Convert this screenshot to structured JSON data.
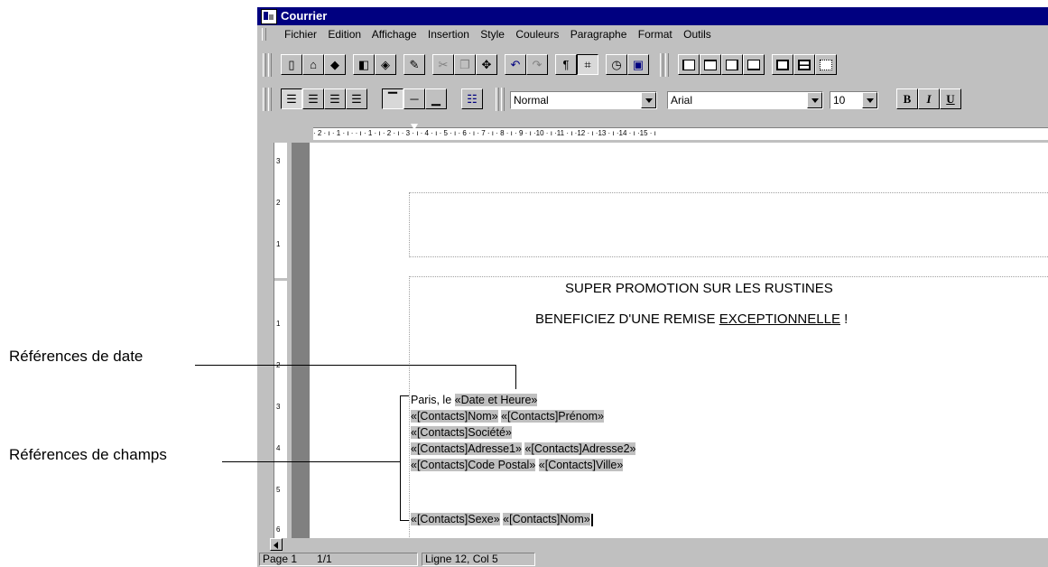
{
  "annotations": {
    "date_ref_label": "Références de date",
    "fields_ref_label": "Références de champs"
  },
  "window": {
    "title": "Courrier",
    "icon": "app-document-icon"
  },
  "menubar": {
    "items": [
      "Fichier",
      "Edition",
      "Affichage",
      "Insertion",
      "Style",
      "Couleurs",
      "Paragraphe",
      "Format",
      "Outils"
    ]
  },
  "toolbar1": {
    "buttons": [
      {
        "icon": "new-document-icon",
        "glyph": "▯"
      },
      {
        "icon": "open-icon",
        "glyph": "⌂"
      },
      {
        "icon": "save-icon",
        "glyph": "◆"
      },
      {
        "icon": "print-preview-icon",
        "glyph": "◧"
      },
      {
        "icon": "print-icon",
        "glyph": "◈"
      },
      {
        "icon": "find-icon",
        "glyph": "✎"
      },
      {
        "icon": "cut-icon",
        "glyph": "✂"
      },
      {
        "icon": "copy-icon",
        "glyph": "❐"
      },
      {
        "icon": "paste-icon",
        "glyph": "✥"
      },
      {
        "icon": "undo-icon",
        "glyph": "↶"
      },
      {
        "icon": "redo-icon",
        "glyph": "↷"
      },
      {
        "icon": "paragraph-marks-icon",
        "glyph": "¶"
      },
      {
        "icon": "field-codes-icon",
        "glyph": "⌗"
      },
      {
        "icon": "insert-date-icon",
        "glyph": "◷"
      },
      {
        "icon": "insert-field-icon",
        "glyph": "▣"
      }
    ],
    "frame_buttons": [
      "frame-left-icon",
      "frame-top-icon",
      "frame-right-icon",
      "frame-bottom-icon",
      "frame-box-icon",
      "frame-split-icon",
      "frame-none-icon"
    ]
  },
  "toolbar2": {
    "align_buttons": [
      "align-left-icon",
      "align-center-icon",
      "align-right-icon",
      "align-justify-icon",
      "valign-top-icon",
      "valign-middle-icon",
      "valign-bottom-icon",
      "bullet-list-icon"
    ],
    "style_value": "Normal",
    "font_value": "Arial",
    "size_value": "10",
    "bold_label": "B",
    "italic_label": "I",
    "underline_label": "U"
  },
  "ruler": {
    "text": "· 2 · ı · 1 · ı ·   · ı · 1 · ı · 2 · ı · 3 · ı · 4 · ı · 5 · ı · 6 · ı · 7 · ı · 8 · ı · 9 · ı ·10 · ı ·11 · ı ·12 · ı ·13 · ı ·14 · ı ·15 · ı",
    "tab_icon": "tab-stop-icon",
    "vertical_numbers": [
      "3",
      "2",
      "1",
      "1",
      "2",
      "3",
      "4",
      "5",
      "6"
    ]
  },
  "document": {
    "heading1": "SUPER PROMOTION SUR LES RUSTINES",
    "heading2_prefix": "BENEFICIEZ D'UNE REMISE ",
    "heading2_underlined": "EXCEPTIONNELLE",
    "heading2_suffix": " !",
    "city_prefix": "Paris, le ",
    "date_field": "«Date et Heure»",
    "f_nom": "«[Contacts]Nom»",
    "f_prenom": "«[Contacts]Prénom»",
    "f_societe": "«[Contacts]Société»",
    "f_adresse1": "«[Contacts]Adresse1»",
    "f_adresse2": "«[Contacts]Adresse2»",
    "f_cp": "«[Contacts]Code Postal»",
    "f_ville": "«[Contacts]Ville»",
    "f_sexe": "«[Contacts]Sexe»",
    "f_nom2": "«[Contacts]Nom»"
  },
  "statusbar": {
    "page": "Page 1",
    "pages": "1/1",
    "position": "Ligne 12, Col 5"
  }
}
